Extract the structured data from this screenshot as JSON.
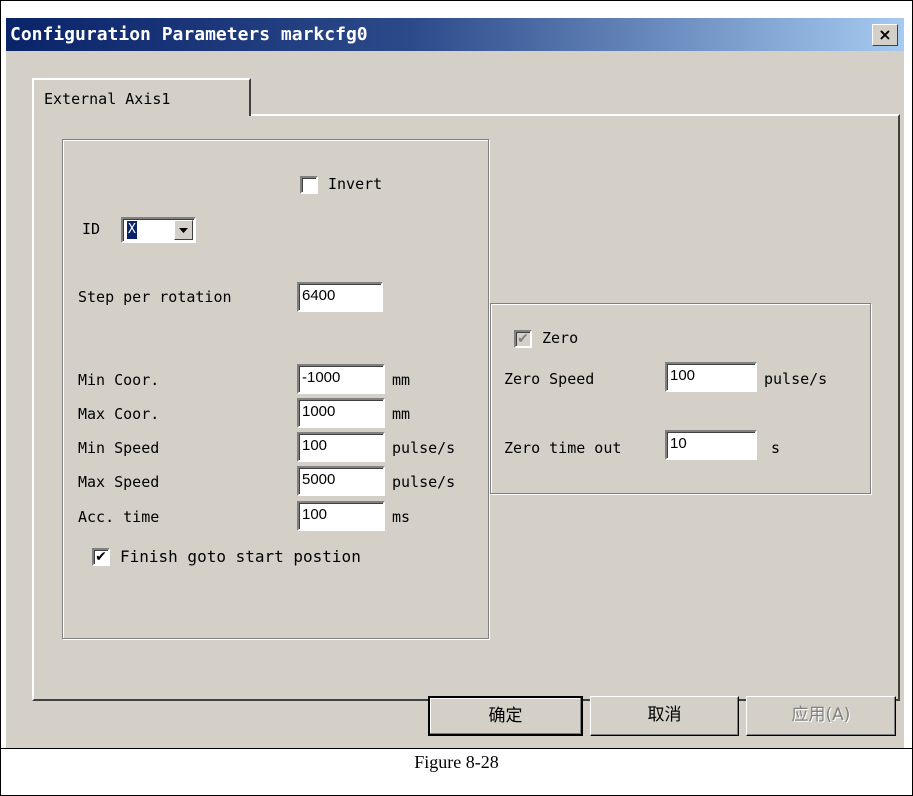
{
  "window": {
    "title": "Configuration Parameters markcfg0",
    "close_glyph": "×"
  },
  "tabs": [
    {
      "label": "External Axis1"
    }
  ],
  "axis": {
    "invert_label": "Invert",
    "id_label": "ID",
    "id_value": "X",
    "step_per_rotation_label": "Step per rotation",
    "step_per_rotation_value": "6400",
    "min_coor_label": "Min Coor.",
    "min_coor_value": "-1000",
    "min_coor_unit": "mm",
    "max_coor_label": "Max Coor.",
    "max_coor_value": "1000",
    "max_coor_unit": "mm",
    "min_speed_label": "Min Speed",
    "min_speed_value": "100",
    "min_speed_unit": "pulse/s",
    "max_speed_label": "Max Speed",
    "max_speed_value": "5000",
    "max_speed_unit": "pulse/s",
    "acc_time_label": "Acc. time",
    "acc_time_value": "100",
    "acc_time_unit": "ms",
    "finish_goto_label": "Finish goto start postion"
  },
  "zero": {
    "zero_label": "Zero",
    "zero_speed_label": "Zero Speed",
    "zero_speed_value": "100",
    "zero_speed_unit": "pulse/s",
    "zero_timeout_label": "Zero time out",
    "zero_timeout_value": "10",
    "zero_timeout_unit": "s"
  },
  "buttons": {
    "ok": "确定",
    "cancel": "取消",
    "apply": "应用(A)"
  },
  "caption": "Figure 8-28",
  "icons": {
    "check": "checkmark-icon",
    "dropdown": "dropdown-arrow-icon",
    "close": "close-icon"
  }
}
